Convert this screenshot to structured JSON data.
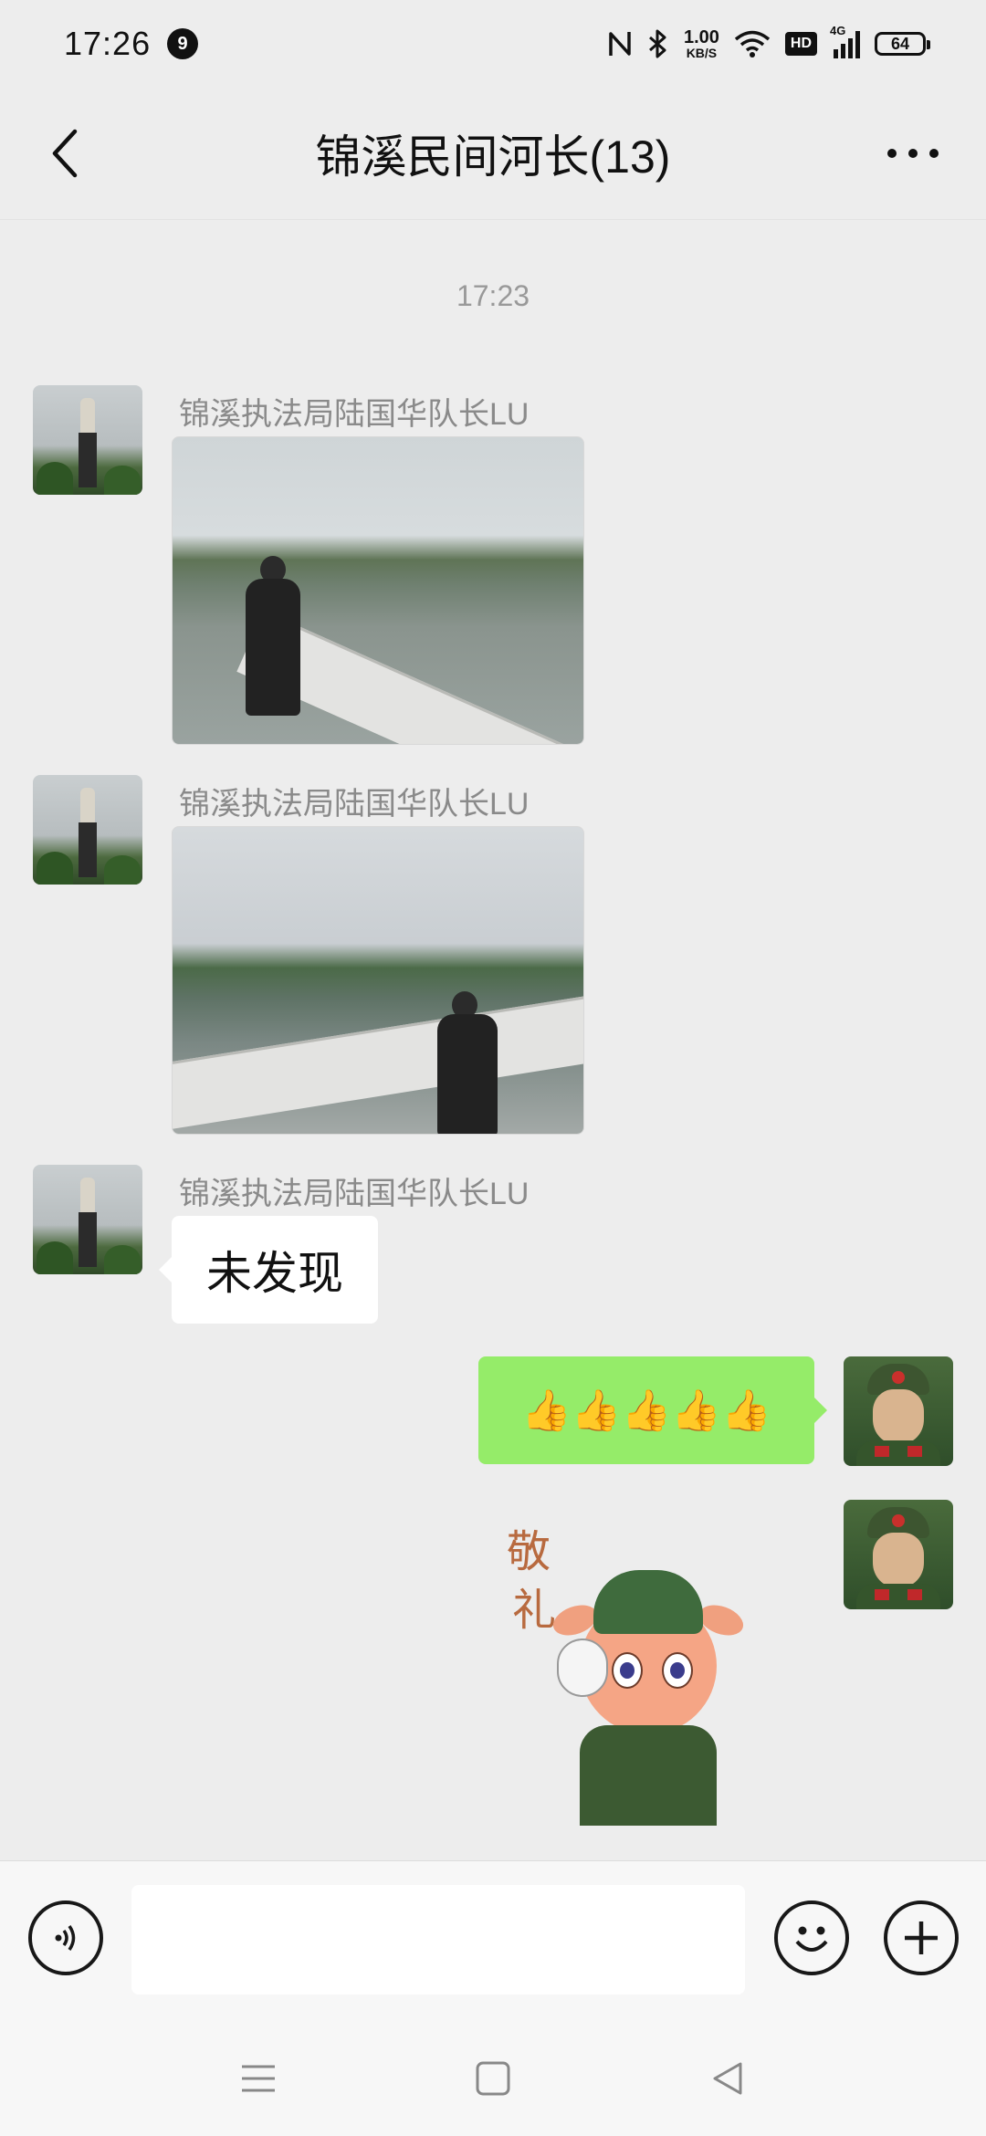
{
  "status_bar": {
    "time": "17:26",
    "notification_count": "9",
    "net_speed_value": "1.00",
    "net_speed_unit": "KB/S",
    "hd_label": "HD",
    "network_label": "4G",
    "battery_level": "64"
  },
  "header": {
    "title": "锦溪民间河长(13)"
  },
  "chat": {
    "time_separator": "17:23",
    "messages": [
      {
        "sender": "锦溪执法局陆国华队长LU",
        "type": "image",
        "side": "left"
      },
      {
        "sender": "锦溪执法局陆国华队长LU",
        "type": "image",
        "side": "left"
      },
      {
        "sender": "锦溪执法局陆国华队长LU",
        "type": "text",
        "side": "left",
        "text": "未发现"
      },
      {
        "sender": "",
        "type": "text",
        "side": "right",
        "text": "👍👍👍👍👍"
      },
      {
        "sender": "",
        "type": "sticker",
        "side": "right",
        "sticker_text_1": "敬",
        "sticker_text_2": "礼"
      }
    ]
  },
  "input_bar": {
    "value": "",
    "placeholder": ""
  },
  "icons": {
    "back": "chevron-left-icon",
    "more": "more-dots-icon",
    "voice": "voice-icon",
    "emoji": "emoji-icon",
    "plus": "plus-icon",
    "nav_menu": "menu-icon",
    "nav_home": "home-icon",
    "nav_back": "back-triangle-icon"
  },
  "colors": {
    "background": "#ededed",
    "own_bubble": "#95ec69",
    "other_bubble": "#ffffff"
  }
}
